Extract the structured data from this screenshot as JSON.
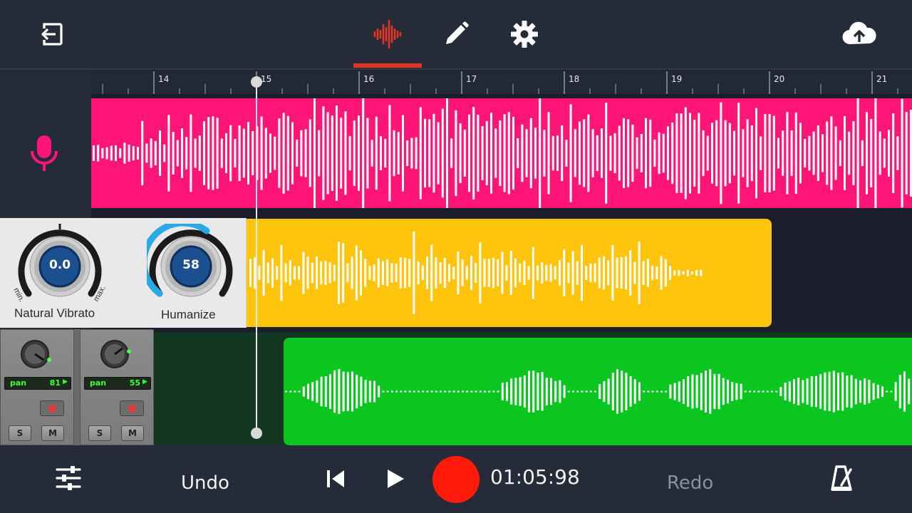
{
  "topbar": {
    "exit_icon": "exit-icon",
    "tabs": [
      {
        "name": "waveform-icon",
        "active": true
      },
      {
        "name": "pencil-icon",
        "active": false
      },
      {
        "name": "gear-icon",
        "active": false
      }
    ],
    "upload_icon": "cloud-upload-icon"
  },
  "ruler": {
    "labels": [
      "14",
      "15",
      "16",
      "17",
      "18",
      "19",
      "20",
      "21"
    ]
  },
  "tracks": {
    "vocal_icon": "microphone-icon",
    "clip_colors": {
      "pink": "#ff1577",
      "yellow": "#ffc40b",
      "green": "#0ac61f"
    }
  },
  "vibrato_panel": {
    "knob1": {
      "value": "0.0",
      "label": "Natural Vibrato",
      "min": "min.",
      "max": "max."
    },
    "knob2": {
      "value": "58",
      "label": "Humanize"
    }
  },
  "mixer": {
    "strips": [
      {
        "pan_label": "pan",
        "pan_value": "81",
        "solo": "S",
        "mute": "M"
      },
      {
        "pan_label": "pan",
        "pan_value": "55",
        "solo": "S",
        "mute": "M"
      }
    ]
  },
  "transport": {
    "undo": "Undo",
    "redo": "Redo",
    "time": "01:05:98",
    "mixer_icon": "sliders-icon",
    "skip_back_icon": "skip-back-icon",
    "play_icon": "play-icon",
    "record_icon": "record-icon",
    "metronome_icon": "metronome-icon"
  },
  "colors": {
    "background": "#252b38",
    "accent": "#e53423",
    "record": "#ff1a0a"
  }
}
